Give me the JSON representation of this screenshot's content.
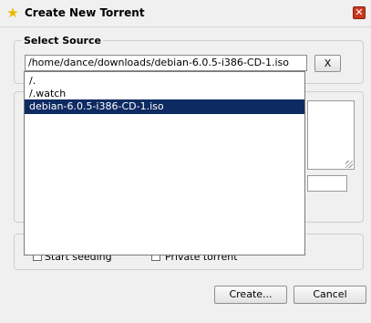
{
  "window": {
    "title": "Create New Torrent",
    "title_icon": "star-icon",
    "close_glyph": "✕"
  },
  "source": {
    "group_title": "Select Source",
    "path_value": "/home/dance/downloads/debian-6.0.5-i386-CD-1.iso",
    "clear_label": "X",
    "dropdown": {
      "items": [
        "/.",
        "/.watch",
        "debian-6.0.5-i386-CD-1.iso"
      ],
      "selected_index": 2
    }
  },
  "options": {
    "start_seeding_label": "Start seeding",
    "private_torrent_label": "Private torrent"
  },
  "buttons": {
    "create_label": "Create...",
    "cancel_label": "Cancel"
  },
  "colors": {
    "selection": "#0e2a62",
    "background": "#f0f0f0"
  }
}
